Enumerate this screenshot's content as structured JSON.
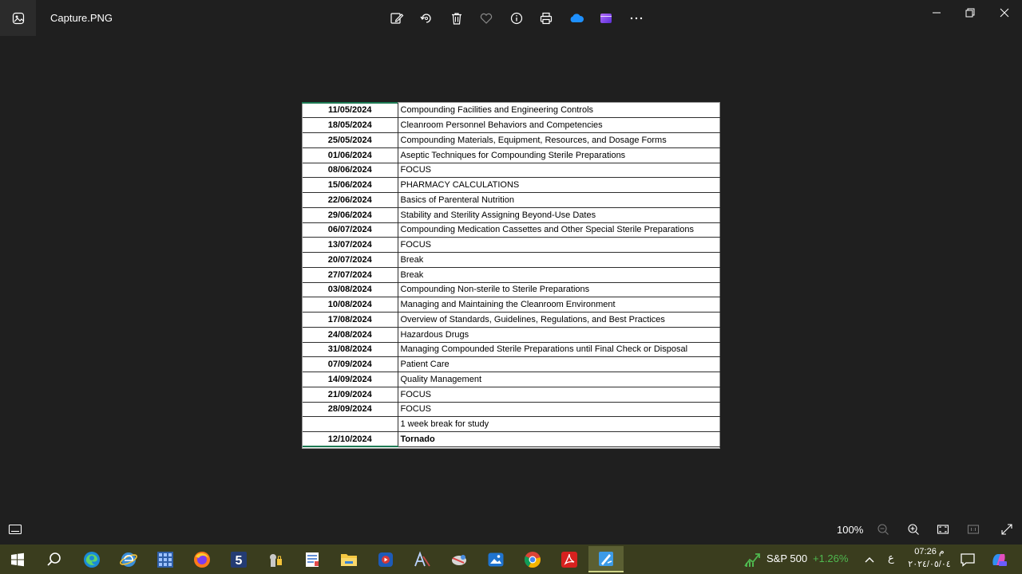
{
  "window": {
    "title": "Capture.PNG",
    "app_icon": "photos-app-icon",
    "toolbar": [
      {
        "name": "edit-icon"
      },
      {
        "name": "rotate-icon"
      },
      {
        "name": "delete-icon"
      },
      {
        "name": "favorite-icon"
      },
      {
        "name": "info-icon"
      },
      {
        "name": "print-icon"
      },
      {
        "name": "onedrive-icon"
      },
      {
        "name": "clipchamp-icon"
      },
      {
        "name": "more-icon"
      }
    ],
    "controls": [
      "minimize-icon",
      "restore-icon",
      "close-icon"
    ]
  },
  "schedule": [
    {
      "date": "11/05/2024",
      "topic": "Compounding Facilities and Engineering Controls"
    },
    {
      "date": "18/05/2024",
      "topic": "Cleanroom Personnel Behaviors and Competencies"
    },
    {
      "date": "25/05/2024",
      "topic": "Compounding Materials, Equipment, Resources, and Dosage Forms"
    },
    {
      "date": "01/06/2024",
      "topic": "Aseptic Techniques for Compounding Sterile Preparations"
    },
    {
      "date": "08/06/2024",
      "topic": "FOCUS"
    },
    {
      "date": "15/06/2024",
      "topic": "PHARMACY CALCULATIONS"
    },
    {
      "date": "22/06/2024",
      "topic": "Basics of Parenteral Nutrition"
    },
    {
      "date": "29/06/2024",
      "topic": "Stability and Sterility Assigning Beyond-Use Dates"
    },
    {
      "date": "06/07/2024",
      "topic": "Compounding Medication Cassettes and Other Special Sterile Preparations"
    },
    {
      "date": "13/07/2024",
      "topic": "FOCUS"
    },
    {
      "date": "20/07/2024",
      "topic": "Break"
    },
    {
      "date": "27/07/2024",
      "topic": "Break"
    },
    {
      "date": "03/08/2024",
      "topic": "Compounding Non-sterile to Sterile Preparations"
    },
    {
      "date": "10/08/2024",
      "topic": "Managing and Maintaining the Cleanroom Environment"
    },
    {
      "date": "17/08/2024",
      "topic": "Overview of Standards, Guidelines, Regulations, and Best Practices"
    },
    {
      "date": "24/08/2024",
      "topic": "Hazardous Drugs"
    },
    {
      "date": "31/08/2024",
      "topic": "Managing Compounded Sterile Preparations until Final Check or Disposal"
    },
    {
      "date": "07/09/2024",
      "topic": "Patient Care"
    },
    {
      "date": "14/09/2024",
      "topic": "Quality Management"
    },
    {
      "date": "21/09/2024",
      "topic": "FOCUS"
    },
    {
      "date": "28/09/2024",
      "topic": "FOCUS"
    },
    {
      "date": "",
      "topic": "1 week break for study"
    },
    {
      "date": "12/10/2024",
      "topic": "Tornado"
    }
  ],
  "bottombar": {
    "zoom": "100%"
  },
  "taskbar": {
    "stock_name": "S&P 500",
    "stock_change": "+1.26%",
    "language": "ع",
    "time": "07:26 م",
    "date": "٢٠٢٤/٠٥/٠٤"
  }
}
